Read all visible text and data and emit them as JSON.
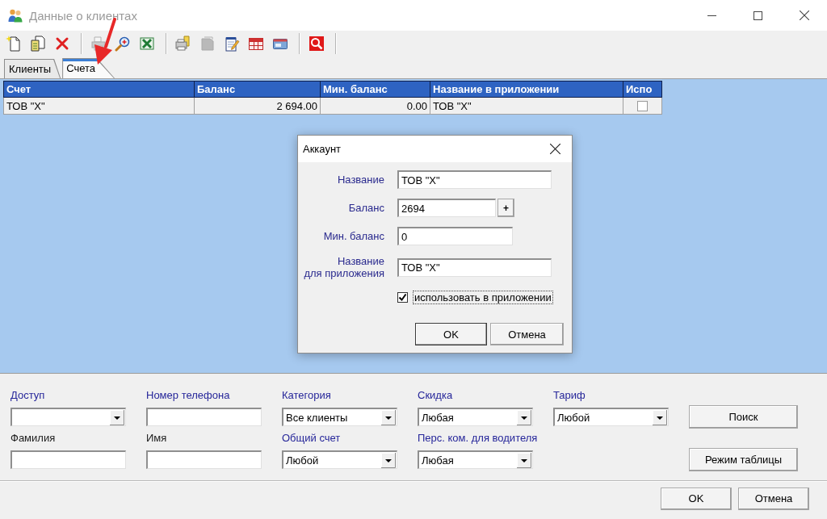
{
  "window": {
    "title": "Данные о клиентах"
  },
  "toolbar": {
    "groups": [
      {
        "items": [
          {
            "kind": "new",
            "disabled": false
          },
          {
            "kind": "edit",
            "disabled": false
          },
          {
            "kind": "delete",
            "disabled": false
          }
        ]
      },
      {
        "items": [
          {
            "kind": "print",
            "disabled": true
          },
          {
            "kind": "zoom",
            "disabled": false
          },
          {
            "kind": "excel",
            "disabled": false
          }
        ]
      },
      {
        "items": [
          {
            "kind": "print_setup",
            "disabled": false
          },
          {
            "kind": "stack",
            "disabled": true
          },
          {
            "kind": "notes",
            "disabled": false
          },
          {
            "kind": "grid",
            "disabled": false
          },
          {
            "kind": "card",
            "disabled": false
          }
        ]
      },
      {
        "items": [
          {
            "kind": "search",
            "disabled": false
          }
        ]
      }
    ]
  },
  "tabs": [
    {
      "label": "Клиенты",
      "selected": false
    },
    {
      "label": "Счета",
      "selected": true
    }
  ],
  "table": {
    "columns": [
      {
        "label": "Счет",
        "kind": "text"
      },
      {
        "label": "Баланс",
        "kind": "number"
      },
      {
        "label": "Мин. баланс",
        "kind": "number"
      },
      {
        "label": "Название в приложении",
        "kind": "text"
      },
      {
        "label": "Испо",
        "kind": "check"
      }
    ],
    "rows": [
      {
        "cells": [
          "ТОВ \"Х\"",
          "2 694.00",
          "0.00",
          "ТОВ \"Х\""
        ],
        "use_in_app": false
      }
    ]
  },
  "dialog": {
    "title": "Аккаунт",
    "fields": [
      {
        "label": "Название",
        "value": "ТОВ \"Х\"",
        "kind": "wide"
      },
      {
        "label": "Баланс",
        "value": "2694",
        "kind": "stepper",
        "button": "+"
      },
      {
        "label": "Мин. баланс",
        "value": "0",
        "kind": "short"
      },
      {
        "label": "Название\nдля приложения",
        "value": "ТОВ \"Х\"",
        "kind": "wide"
      }
    ],
    "checkbox": {
      "label": "использовать в приложении",
      "checked": true,
      "focused": true
    },
    "buttons": [
      {
        "label": "OK",
        "default": true
      },
      {
        "label": "Отмена",
        "default": false
      }
    ]
  },
  "filters": {
    "rows": [
      {
        "fields": [
          {
            "label": "Доступ",
            "color": "#26269a",
            "kind": "combo"
          },
          {
            "label": "Номер телефона",
            "color": "#26269a",
            "kind": "text"
          },
          {
            "label": "Категория",
            "color": "#26269a",
            "kind": "combo",
            "value": "Все клиенты"
          },
          {
            "label": "Скидка",
            "color": "#26269a",
            "kind": "combo",
            "value": "Любая"
          },
          {
            "label": "Тариф",
            "color": "#26269a",
            "kind": "combo",
            "value": "Любой"
          }
        ],
        "button": "Поиск"
      },
      {
        "fields": [
          {
            "label": "Фамилия",
            "color": "#202020",
            "kind": "text"
          },
          {
            "label": "Имя",
            "color": "#202020",
            "kind": "text"
          },
          {
            "label": "Общий счет",
            "color": "#26269a",
            "kind": "combo",
            "value": "Любой"
          },
          {
            "label": "Перс. ком. для водителя",
            "color": "#26269a",
            "kind": "combo",
            "value": "Любая"
          }
        ],
        "button": "Режим таблицы"
      }
    ]
  },
  "footer": {
    "buttons": [
      "OK",
      "Отмена"
    ]
  }
}
